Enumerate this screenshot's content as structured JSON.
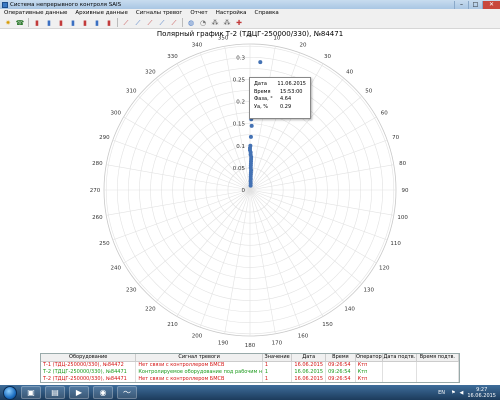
{
  "window": {
    "title": "Система непрерывного контроля SAIS"
  },
  "menu": {
    "items": [
      "Оперативные данные",
      "Архивные данные",
      "Сигналы тревог",
      "Отчет",
      "Настройка",
      "Справка"
    ]
  },
  "toolbar": {
    "icons": [
      "star-icon",
      "phone-icon",
      "bar-chart-icon",
      "bar-chart-icon",
      "bar-chart-icon",
      "bar-chart-icon",
      "bar-chart-icon",
      "bar-chart-icon",
      "bar-chart-icon",
      "line-chart-icon",
      "line-chart-icon",
      "line-chart-icon",
      "line-chart-icon",
      "line-chart-icon",
      "globe-icon",
      "gauge-icon",
      "network-icon",
      "network-icon",
      "settings-icon"
    ]
  },
  "chart_data": {
    "type": "scatter",
    "title": "Полярный график   Т-2 (ТДЦГ-250000/330), №84471",
    "coordinates": "polar",
    "r_ticks": [
      "0",
      "0.05",
      "0.1",
      "0.15",
      "0.2",
      "0.25",
      "0.3"
    ],
    "rlim": [
      0,
      0.33
    ],
    "angle_ticks": [
      "0",
      "10",
      "20",
      "30",
      "40",
      "50",
      "60",
      "70",
      "80",
      "90",
      "100",
      "110",
      "120",
      "130",
      "140",
      "150",
      "160",
      "170",
      "180",
      "190",
      "200",
      "210",
      "220",
      "230",
      "240",
      "250",
      "260",
      "270",
      "280",
      "290",
      "300",
      "310",
      "320",
      "330",
      "340",
      "350"
    ],
    "series": [
      {
        "color": "#4472b4",
        "points": [
          {
            "angle": 4.6,
            "r": 0.29
          },
          {
            "angle": 2.0,
            "r": 0.21
          },
          {
            "angle": 1.0,
            "r": 0.16
          },
          {
            "angle": 1.5,
            "r": 0.145
          },
          {
            "angle": 1.0,
            "r": 0.12
          },
          {
            "angle": 0.5,
            "r": 0.1
          },
          {
            "angle": 0.0,
            "r": 0.095
          },
          {
            "angle": 0.0,
            "r": 0.09
          },
          {
            "angle": 1.0,
            "r": 0.085
          },
          {
            "angle": 1.0,
            "r": 0.08
          },
          {
            "angle": 2.0,
            "r": 0.075
          },
          {
            "angle": 2.0,
            "r": 0.07
          },
          {
            "angle": 2.0,
            "r": 0.065
          },
          {
            "angle": 2.0,
            "r": 0.06
          },
          {
            "angle": 2.0,
            "r": 0.055
          },
          {
            "angle": 2.0,
            "r": 0.05
          },
          {
            "angle": 3.0,
            "r": 0.045
          },
          {
            "angle": 3.0,
            "r": 0.04
          },
          {
            "angle": 3.0,
            "r": 0.035
          },
          {
            "angle": 3.0,
            "r": 0.03
          },
          {
            "angle": 4.0,
            "r": 0.025
          },
          {
            "angle": 4.0,
            "r": 0.02
          },
          {
            "angle": 6.0,
            "r": 0.015
          },
          {
            "angle": 8.0,
            "r": 0.01
          }
        ]
      }
    ],
    "tooltip": {
      "rows": [
        {
          "key": "Дата",
          "value": "11.06.2015"
        },
        {
          "key": "Время",
          "value": "15:53:00"
        },
        {
          "key": "Фаза, °",
          "value": "4.64"
        },
        {
          "key": "Уа, %",
          "value": "0.29"
        }
      ]
    }
  },
  "alarms": {
    "columns": [
      "Оборудование",
      "Сигнал тревоги",
      "Значение",
      "Дата",
      "Время",
      "Оператор",
      "Дата подтв.",
      "Время подтв."
    ],
    "rows": [
      {
        "severity": "red",
        "cells": [
          "Т-1 (ТДЦ-250000/330), №84472",
          "Нет связи с контроллером БМСВ",
          "1",
          "16.06.2015",
          "09:26:54",
          "Ктп",
          "",
          ""
        ]
      },
      {
        "severity": "green",
        "cells": [
          "Т-2 (ТДЦГ-250000/330), №84471",
          "Контролируемое оборудование под рабочим напряжением",
          "1",
          "16.06.2015",
          "09:26:54",
          "Ктп",
          "",
          ""
        ]
      },
      {
        "severity": "red",
        "cells": [
          "Т-2 (ТДЦГ-250000/330), №84471",
          "Нет связи с контроллером БМСВ",
          "1",
          "16.06.2015",
          "09:26:54",
          "Ктп",
          "",
          ""
        ]
      }
    ]
  },
  "taskbar": {
    "language": "EN",
    "time": "9:27",
    "date": "16.06.2015"
  },
  "colors": {
    "alarm_red": "#d41313",
    "alarm_green": "#1a9a1a",
    "series": "#4472b4"
  }
}
